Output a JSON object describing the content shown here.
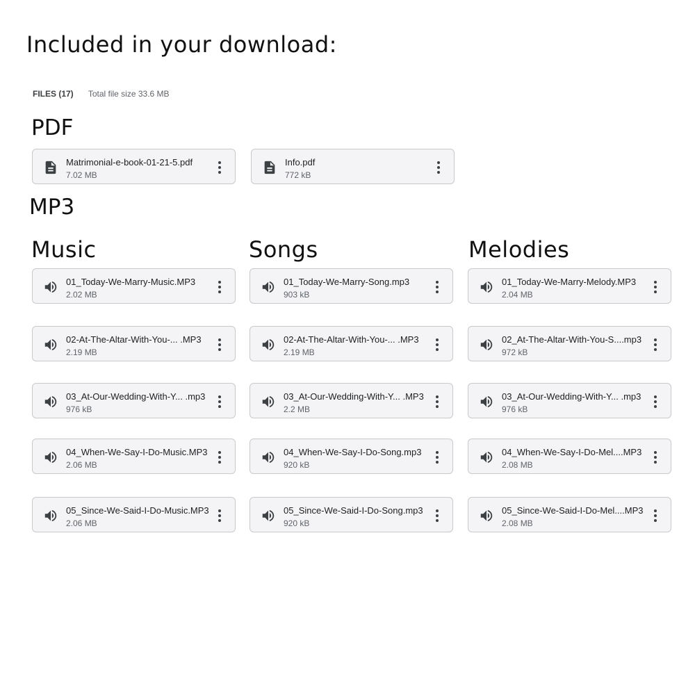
{
  "heading": "Included in your download:",
  "files_info": {
    "count_label": "FILES (17)",
    "total_label": "Total file size",
    "total_value": "33.6 MB"
  },
  "pdf_section": {
    "label": "PDF",
    "files": [
      {
        "name": "Matrimonial-e-book-01-21-5.pdf",
        "size": "7.02 MB",
        "icon": "document-icon"
      },
      {
        "name": "Info.pdf",
        "size": "772 kB",
        "icon": "document-icon"
      }
    ]
  },
  "mp3_section": {
    "label": "MP3",
    "columns": [
      {
        "heading": "Music",
        "files": [
          {
            "name": "01_Today-We-Marry-Music.MP3",
            "size": "2.02 MB",
            "icon": "speaker-icon"
          },
          {
            "name": "02-At-The-Altar-With-You-... .MP3",
            "size": "2.19 MB",
            "icon": "speaker-icon"
          },
          {
            "name": "03_At-Our-Wedding-With-Y... .mp3",
            "size": "976 kB",
            "icon": "speaker-icon"
          },
          {
            "name": "04_When-We-Say-I-Do-Music.MP3",
            "size": "2.06 MB",
            "icon": "speaker-icon"
          },
          {
            "name": "05_Since-We-Said-I-Do-Music.MP3",
            "size": "2.06 MB",
            "icon": "speaker-icon"
          }
        ]
      },
      {
        "heading": "Songs",
        "files": [
          {
            "name": "01_Today-We-Marry-Song.mp3",
            "size": "903 kB",
            "icon": "speaker-icon"
          },
          {
            "name": "02-At-The-Altar-With-You-... .MP3",
            "size": "2.19 MB",
            "icon": "speaker-icon"
          },
          {
            "name": "03_At-Our-Wedding-With-Y... .MP3",
            "size": "2.2 MB",
            "icon": "speaker-icon"
          },
          {
            "name": "04_When-We-Say-I-Do-Song.mp3",
            "size": "920 kB",
            "icon": "speaker-icon"
          },
          {
            "name": "05_Since-We-Said-I-Do-Song.mp3",
            "size": "920 kB",
            "icon": "speaker-icon"
          }
        ]
      },
      {
        "heading": "Melodies",
        "files": [
          {
            "name": "01_Today-We-Marry-Melody.MP3",
            "size": "2.04 MB",
            "icon": "speaker-icon"
          },
          {
            "name": "02_At-The-Altar-With-You-S....mp3",
            "size": "972 kB",
            "icon": "speaker-icon"
          },
          {
            "name": "03_At-Our-Wedding-With-Y... .mp3",
            "size": "976 kB",
            "icon": "speaker-icon"
          },
          {
            "name": "04_When-We-Say-I-Do-Mel....MP3",
            "size": "2.08 MB",
            "icon": "speaker-icon"
          },
          {
            "name": "05_Since-We-Said-I-Do-Mel....MP3",
            "size": "2.08 MB",
            "icon": "speaker-icon"
          }
        ]
      }
    ]
  }
}
